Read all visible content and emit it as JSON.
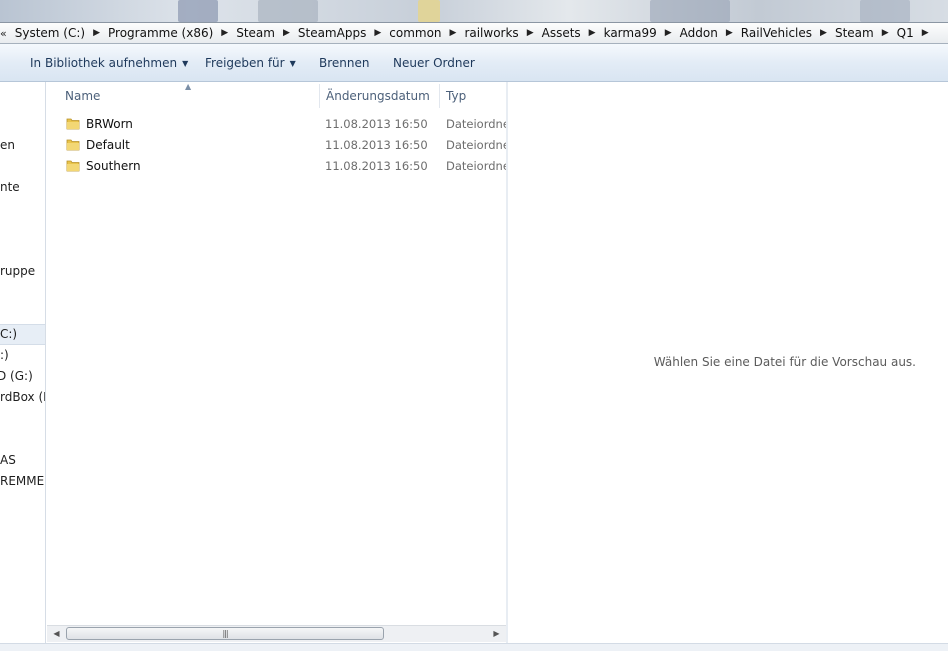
{
  "address_bar": {
    "crumbs": [
      "System (C:)",
      "Programme (x86)",
      "Steam",
      "SteamApps",
      "common",
      "railworks",
      "Assets",
      "karma99",
      "Addon",
      "RailVehicles",
      "Steam",
      "Q1"
    ]
  },
  "toolbar": {
    "add_to_library": "In Bibliothek aufnehmen",
    "share_with": "Freigeben für",
    "burn": "Brennen",
    "new_folder": "Neuer Ordner"
  },
  "nav_pane": {
    "items": [
      "en",
      "nte",
      "ruppe",
      "C:)",
      ":)",
      "D (G:)",
      "rdBox (H:",
      "AS",
      "REMMER"
    ],
    "selected_index": 3
  },
  "file_list": {
    "columns": {
      "name": "Name",
      "date": "Änderungsdatum",
      "type": "Typ"
    },
    "rows": [
      {
        "name": "BRWorn",
        "date": "11.08.2013 16:50",
        "type": "Dateiordner"
      },
      {
        "name": "Default",
        "date": "11.08.2013 16:50",
        "type": "Dateiordner"
      },
      {
        "name": "Southern",
        "date": "11.08.2013 16:50",
        "type": "Dateiordner"
      }
    ]
  },
  "preview_pane": {
    "message": "Wählen Sie eine Datei für die Vorschau aus."
  },
  "colors": {
    "toolbar_text": "#1e395b",
    "folder_yellow": "#e8c34a",
    "selected_nav": "#e7eef6"
  }
}
